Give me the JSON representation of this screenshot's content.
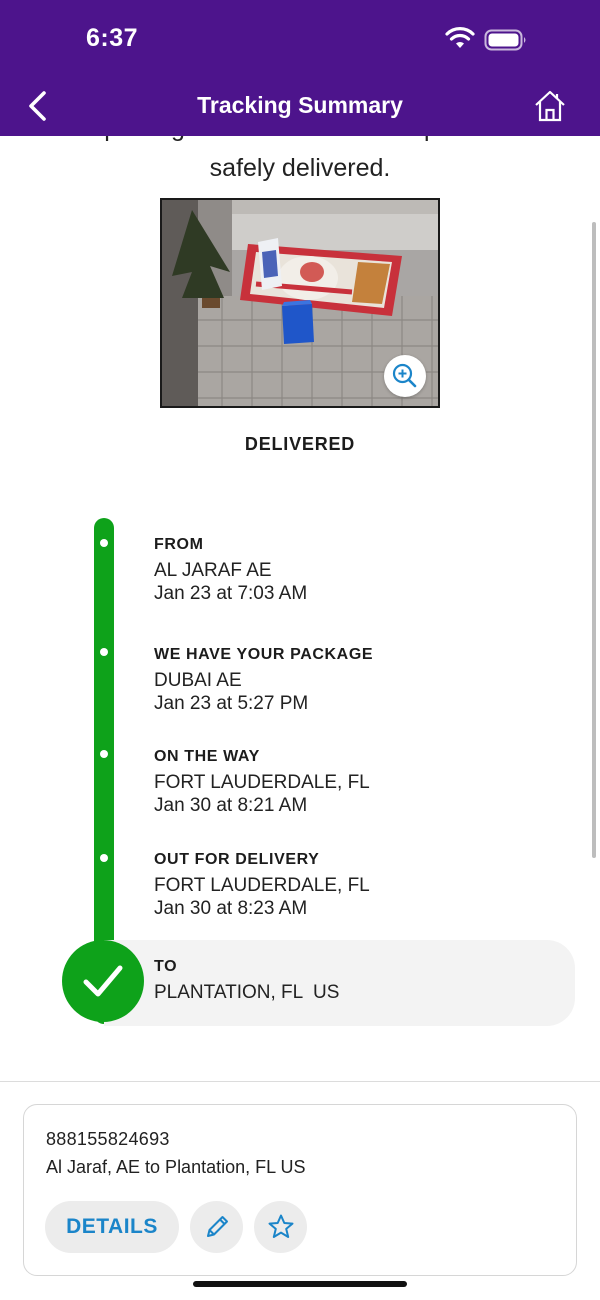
{
  "status_bar": {
    "time": "6:37",
    "icons": [
      "wifi-icon",
      "battery-icon"
    ]
  },
  "nav": {
    "title": "Tracking Summary",
    "back_icon": "chevron-left-icon",
    "home_icon": "home-icon"
  },
  "summary": {
    "message": "Your package was released as requested and safely delivered.",
    "message_line1": "Your package was released as requested and",
    "message_line2": "safely delivered.",
    "photo_alt": "Delivery photo of package on doorstep",
    "zoom_icon": "zoom-in-icon",
    "status": "DELIVERED"
  },
  "timeline": [
    {
      "title": "FROM",
      "lines": [
        "AL JARAF AE",
        "Jan 23 at 7:03 AM"
      ]
    },
    {
      "title": "WE HAVE YOUR PACKAGE",
      "lines": [
        "DUBAI AE",
        "Jan 23 at 5:27 PM"
      ]
    },
    {
      "title": "ON THE WAY",
      "lines": [
        "FORT LAUDERDALE, FL",
        "Jan 30 at 8:21 AM"
      ]
    },
    {
      "title": "OUT FOR DELIVERY",
      "lines": [
        "FORT LAUDERDALE, FL",
        "Jan 30 at 8:23 AM"
      ]
    },
    {
      "title": "TO",
      "lines": [
        "PLANTATION, FL  US"
      ]
    }
  ],
  "card": {
    "tracking_number": "888155824693",
    "route": "Al Jaraf, AE to Plantation, FL US",
    "details_label": "DETAILS",
    "edit_icon": "pencil-icon",
    "favorite_icon": "star-icon"
  },
  "colors": {
    "header": "#4d148c",
    "timeline_green": "#0ea21a",
    "link_blue": "#1b85c9"
  }
}
